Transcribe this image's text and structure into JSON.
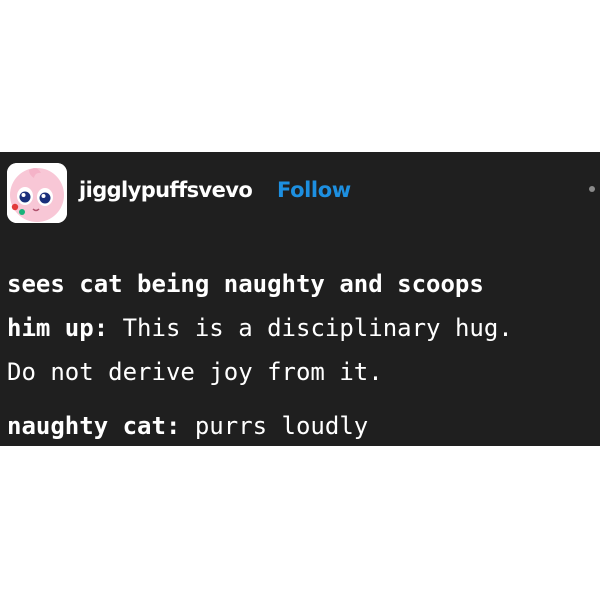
{
  "post": {
    "username": "jigglypuffsvevo",
    "follow_label": "Follow",
    "avatar_icon": "jigglypuff-avatar-icon",
    "more_icon": "more-options-icon",
    "accent_color": "#1d8fe0",
    "background_color": "#1f1f1f",
    "lines": [
      {
        "bold": "sees cat being naughty and scoops",
        "normal": ""
      },
      {
        "bold": "him up:",
        "normal": " This is a disciplinary hug."
      },
      {
        "bold": "",
        "normal": "Do not derive joy from it."
      },
      {
        "bold": "naughty cat:",
        "normal": " purrs loudly"
      }
    ]
  }
}
